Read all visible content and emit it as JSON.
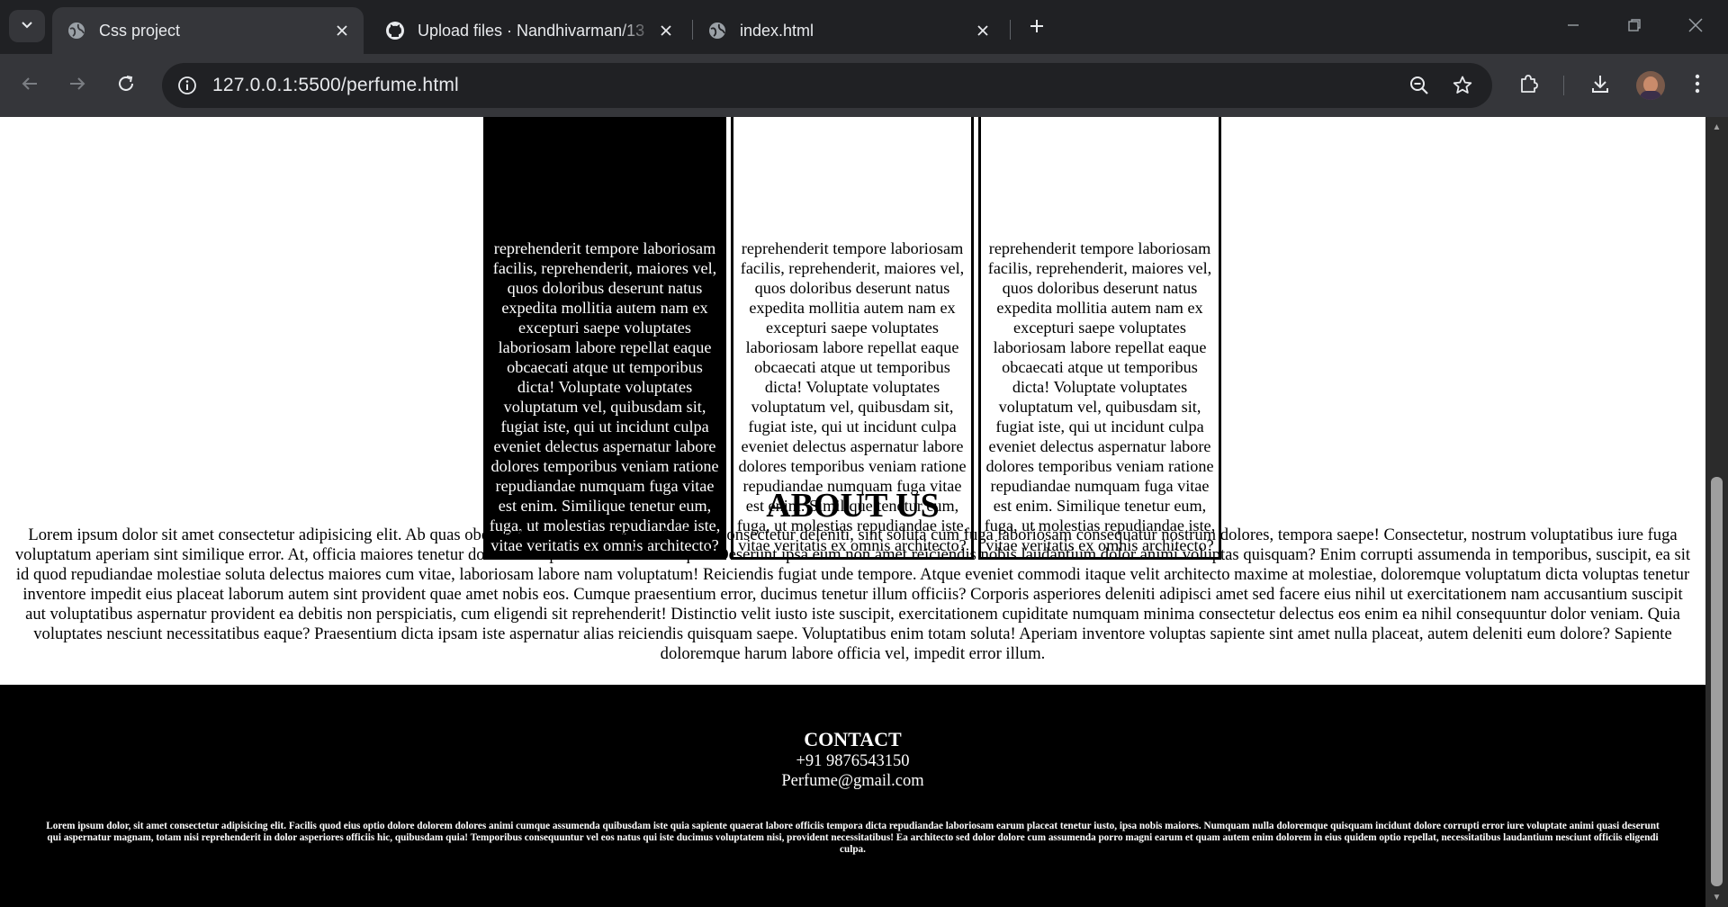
{
  "browser": {
    "tabs": [
      {
        "title": "Css project",
        "favicon": "globe-icon",
        "active": true
      },
      {
        "title": "Upload files · Nandhivarman/13",
        "favicon": "github-icon",
        "active": false
      },
      {
        "title": "index.html",
        "favicon": "globe-icon",
        "active": false
      }
    ],
    "url": "127.0.0.1:5500/perfume.html"
  },
  "page": {
    "cards": [
      {
        "style": "dark",
        "partial_top": "reprehenderit tempore laboriosam",
        "text": "facilis, reprehenderit, maiores vel, quos doloribus deserunt natus expedita mollitia autem nam ex excepturi saepe voluptates laboriosam labore repellat eaque obcaecati atque ut temporibus dicta! Voluptate voluptates voluptatum vel, quibusdam sit, fugiat iste, qui ut incidunt culpa eveniet delectus aspernatur labore dolores temporibus veniam ratione repudiandae numquam fuga vitae est enim. Similique tenetur eum, fuga, ut molestias repudiandae iste, vitae veritatis ex omnis architecto?"
      },
      {
        "style": "light",
        "partial_top": "reprehenderit tempore laboriosam",
        "text": "facilis, reprehenderit, maiores vel, quos doloribus deserunt natus expedita mollitia autem nam ex excepturi saepe voluptates laboriosam labore repellat eaque obcaecati atque ut temporibus dicta! Voluptate voluptates voluptatum vel, quibusdam sit, fugiat iste, qui ut incidunt culpa eveniet delectus aspernatur labore dolores temporibus veniam ratione repudiandae numquam fuga vitae est enim. Similique tenetur eum, fuga, ut molestias repudiandae iste, vitae veritatis ex omnis architecto?"
      },
      {
        "style": "light",
        "partial_top": "reprehenderit tempore laboriosam",
        "text": "facilis, reprehenderit, maiores vel, quos doloribus deserunt natus expedita mollitia autem nam ex excepturi saepe voluptates laboriosam labore repellat eaque obcaecati atque ut temporibus dicta! Voluptate voluptates voluptatum vel, quibusdam sit, fugiat iste, qui ut incidunt culpa eveniet delectus aspernatur labore dolores temporibus veniam ratione repudiandae numquam fuga vitae est enim. Similique tenetur eum, fuga, ut molestias repudiandae iste, vitae veritatis ex omnis architecto?"
      }
    ],
    "about": {
      "heading": "ABOUT US",
      "body": "Lorem ipsum dolor sit amet consectetur adipisicing elit. Ab quas obcaecati dicta error unde at ducimus consectetur deleniti, sint soluta cum fuga laboriosam consequatur nostrum dolores, tempora saepe! Consectetur, nostrum voluptatibus iure fuga voluptatum aperiam sint similique error. At, officia maiores tenetur dolorem saepe nostrum dolores quo! Deserunt ipsa eum non amet reiciendis nobis laudantium dolor animi voluptas quisquam? Enim corrupti assumenda in temporibus, suscipit, ea sit id quod repudiandae molestiae soluta delectus maiores cum vitae, laboriosam labore nam voluptatum! Reiciendis fugiat unde tempore. Atque eveniet commodi itaque velit architecto maxime at molestiae, doloremque voluptatum dicta voluptas tenetur inventore impedit eius placeat laborum autem sint provident quae amet nobis eos. Cumque praesentium error, ducimus tenetur illum officiis? Corporis asperiores deleniti adipisci amet sed facere eius nihil ut exercitationem nam accusantium suscipit aut voluptatibus aspernatur provident ea debitis non perspiciatis, cum eligendi sit reprehenderit! Distinctio velit iusto iste suscipit, exercitationem cupiditate numquam minima consectetur delectus eos enim ea nihil consequuntur dolor veniam. Quia voluptates nesciunt necessitatibus eaque? Praesentium dicta ipsam iste aspernatur alias reiciendis quisquam saepe. Voluptatibus enim totam soluta! Aperiam inventore voluptas sapiente sint amet nulla placeat, autem deleniti eum dolore? Sapiente doloremque harum labore officia vel, impedit error illum."
    },
    "footer": {
      "heading": "CONTACT",
      "phone": "+91 9876543150",
      "email": "Perfume@gmail.com",
      "fine_print": "Lorem ipsum dolor, sit amet consectetur adipisicing elit. Facilis quod eius optio dolore dolorem dolores animi cumque assumenda quibusdam iste quia sapiente quaerat labore officiis tempora dicta repudiandae laboriosam earum placeat tenetur iusto, ipsa nobis maiores. Numquam nulla doloremque quisquam incidunt dolore corrupti error iure voluptate animi quasi deserunt qui aspernatur magnam, totam nisi reprehenderit in dolor asperiores officiis hic, quibusdam quia! Temporibus consequuntur vel eos natus qui iste ducimus voluptatem nisi, provident necessitatibus! Ea architecto sed dolor dolore cum assumenda porro magni earum et quam autem enim dolorem in eius quidem optio repellat, necessitatibus laudantium nesciunt officiis eligendi culpa."
    }
  },
  "colors": {
    "chrome_dark": "#202124",
    "chrome_toolbar": "#35363a",
    "page_bg": "#ffffff",
    "footer_bg": "#000000"
  }
}
